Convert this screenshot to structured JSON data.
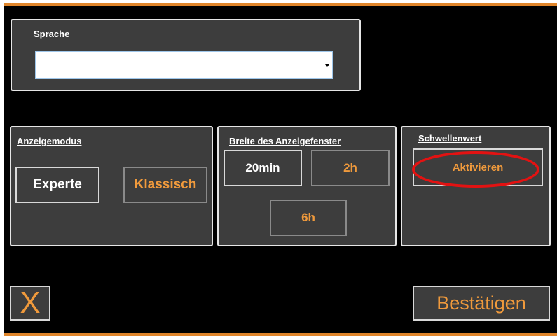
{
  "language_panel": {
    "title": "Sprache",
    "dropdown": {
      "value": ""
    }
  },
  "display_mode_panel": {
    "title": "Anzeigemodus",
    "buttons": {
      "expert": "Experte",
      "classic": "Klassisch"
    }
  },
  "window_width_panel": {
    "title": "Breite des Anzeigefenster",
    "buttons": {
      "20min": "20min",
      "2h": "2h",
      "6h": "6h"
    }
  },
  "threshold_panel": {
    "title": "Schwellenwert",
    "activate_label": "Aktivieren"
  },
  "footer": {
    "close_label": "X",
    "confirm_label": "Bestätigen"
  },
  "colors": {
    "background": "#000000",
    "panel": "#3d3d3d",
    "accent_orange": "#f09a3c",
    "frame_orange": "#e0852a",
    "highlight_red": "#e31212"
  },
  "icons": {
    "dropdown": "chevron-down-icon"
  }
}
